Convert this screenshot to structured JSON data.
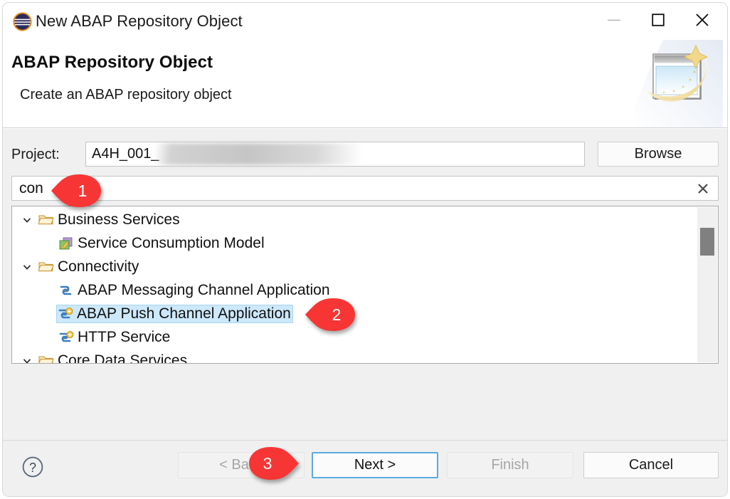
{
  "window": {
    "icon": "eclipse-icon",
    "title": "New ABAP Repository Object",
    "controls": {
      "minimize": "minimize-icon",
      "maximize": "maximize-icon",
      "close": "close-icon"
    }
  },
  "header": {
    "title": "ABAP Repository Object",
    "description": "Create an ABAP repository object",
    "banner_icon": "wizard-banner-icon"
  },
  "form": {
    "project_label": "Project:",
    "project_value": "A4H_001_",
    "project_placeholder": "",
    "browse_label": "Browse",
    "filter_value": "con",
    "filter_placeholder": "",
    "clear_icon": "clear-x-icon"
  },
  "tree": {
    "rows": [
      {
        "label": "Business Services",
        "level": 0,
        "expanded": true,
        "icon": "folder-open-icon",
        "selected": false
      },
      {
        "label": "Service Consumption Model",
        "level": 1,
        "expanded": null,
        "icon": "service-model-icon",
        "selected": false
      },
      {
        "label": "Connectivity",
        "level": 0,
        "expanded": true,
        "icon": "folder-open-icon",
        "selected": false
      },
      {
        "label": "ABAP Messaging Channel Application",
        "level": 1,
        "expanded": null,
        "icon": "channel-icon",
        "selected": false
      },
      {
        "label": "ABAP Push Channel Application",
        "level": 1,
        "expanded": null,
        "icon": "channel-new-icon",
        "selected": true
      },
      {
        "label": "HTTP Service",
        "level": 1,
        "expanded": null,
        "icon": "channel-new-icon",
        "selected": false
      },
      {
        "label": "Core Data Services",
        "level": 0,
        "expanded": true,
        "icon": "folder-open-icon",
        "selected": false
      }
    ],
    "scrollbar": "vertical-scrollbar"
  },
  "footer": {
    "help_icon": "help-icon",
    "buttons": [
      {
        "label": "< Back",
        "state": "disabled"
      },
      {
        "label": "Next >",
        "state": "focused"
      },
      {
        "label": "Finish",
        "state": "disabled"
      },
      {
        "label": "Cancel",
        "state": "normal"
      }
    ]
  },
  "markers": [
    {
      "number": "1",
      "direction": "left"
    },
    {
      "number": "2",
      "direction": "left"
    },
    {
      "number": "3",
      "direction": "right"
    }
  ],
  "colors": {
    "marker_red": "#f73535",
    "selection_blue": "#cde8fb",
    "focus_blue": "#5aaae0",
    "body_gray": "#f0f0f0"
  }
}
